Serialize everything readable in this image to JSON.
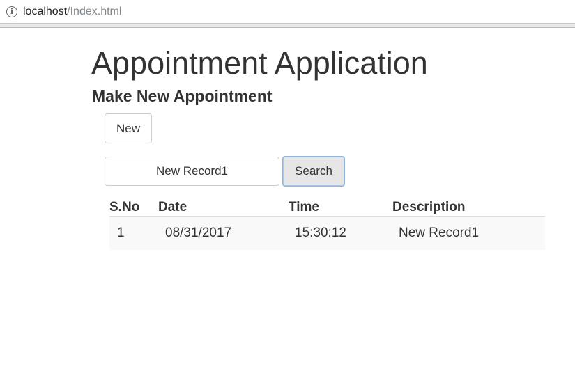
{
  "browser": {
    "url_host": "localhost",
    "url_path": "/Index.html",
    "info_icon": "i"
  },
  "page": {
    "title": "Appointment Application",
    "subtitle": "Make New Appointment"
  },
  "actions": {
    "new_label": "New",
    "search_value": "New Record1",
    "search_label": "Search"
  },
  "table": {
    "headers": {
      "sno": "S.No",
      "date": "Date",
      "time": "Time",
      "description": "Description"
    },
    "rows": [
      {
        "sno": "1",
        "date": "08/31/2017",
        "time": "15:30:12",
        "description": "New Record1"
      }
    ]
  },
  "colors": {
    "text": "#333333",
    "row_stripe": "#f9f9f9",
    "search_focus_border": "#8db4e2"
  }
}
